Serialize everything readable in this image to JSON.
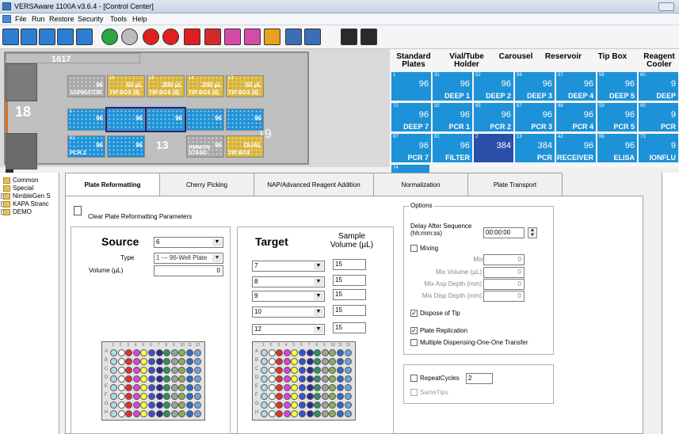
{
  "window": {
    "title": "VERSAware 1100A v3.6.4 - [Control Center]"
  },
  "menu": [
    "File",
    "Run",
    "Restore",
    "Security",
    "Tools",
    "Help"
  ],
  "toolbar": [
    "new-icon",
    "open-icon",
    "save-icon",
    "save-as-icon",
    "delete-icon",
    "run-icon",
    "pause-icon",
    "stop-icon",
    "refresh-icon",
    "home-icon",
    "info-icon",
    "deck-icon",
    "transfer-icon",
    "color-grid-icon",
    "plate-icon",
    "layout-icon",
    "columns-icon",
    "list-icon"
  ],
  "deck": {
    "header_label": "1617",
    "side_number": "18",
    "station_19": "19",
    "station_13": "13",
    "positions": [
      {
        "slot": "",
        "top": "96",
        "bottom": "ASPIRATOR",
        "type": "aspirator"
      },
      {
        "slot": "16",
        "top": "50 µL",
        "bottom": "TIP BOX (8)",
        "type": "tip"
      },
      {
        "slot": "15",
        "top": "200 µL",
        "bottom": "TIP BOX (8)",
        "type": "tip"
      },
      {
        "slot": "14",
        "top": "200 µL",
        "bottom": "TIP BOX (8)",
        "type": "tip"
      },
      {
        "slot": "13",
        "top": "50 µL",
        "bottom": "TIP BOX (8)",
        "type": "tip"
      },
      {
        "slot": "1",
        "top": "96",
        "bottom": "",
        "type": "plate"
      },
      {
        "slot": "",
        "top": "96",
        "bottom": "",
        "type": "plate-sel"
      },
      {
        "slot": "",
        "top": "96",
        "bottom": "",
        "type": "plate-sel"
      },
      {
        "slot": "",
        "top": "96",
        "bottom": "",
        "type": "plate"
      },
      {
        "slot": "",
        "top": "96",
        "bottom": "",
        "type": "plate"
      },
      {
        "slot": "62",
        "top": "96",
        "bottom": "PCR 2",
        "type": "pcr"
      },
      {
        "slot": "",
        "top": "96",
        "bottom": "",
        "type": "plate"
      },
      {
        "slot": "",
        "top": "96",
        "bottom": "AMMON STAND",
        "type": "stand"
      },
      {
        "slot": "",
        "top": "DUAL",
        "bottom": "TIP BOX",
        "type": "tip"
      }
    ]
  },
  "plate_tabs": {
    "headers": [
      "Standard Plates",
      "Vial/Tube Holder",
      "Carousel",
      "Reservoir",
      "Tip Box",
      "Reagent Cooler"
    ],
    "plates": [
      {
        "n": "1",
        "v": "96",
        "m": ""
      },
      {
        "n": "31",
        "v": "96",
        "m": "DEEP 1"
      },
      {
        "n": "52",
        "v": "96",
        "m": "DEEP 2"
      },
      {
        "n": "56",
        "v": "96",
        "m": "DEEP 3"
      },
      {
        "n": "57",
        "v": "96",
        "m": "DEEP 4"
      },
      {
        "n": "58",
        "v": "96",
        "m": "DEEP 5"
      },
      {
        "n": "60",
        "v": "9",
        "m": "DEEP"
      },
      {
        "n": "72",
        "v": "96",
        "m": "DEEP 7"
      },
      {
        "n": "32",
        "v": "96",
        "m": "PCR 1"
      },
      {
        "n": "85",
        "v": "96",
        "m": "PCR 2"
      },
      {
        "n": "87",
        "v": "96",
        "m": "PCR 3"
      },
      {
        "n": "88",
        "v": "96",
        "m": "PCR 4"
      },
      {
        "n": "59",
        "v": "96",
        "m": "PCR 5"
      },
      {
        "n": "90",
        "v": "9",
        "m": "PCR"
      },
      {
        "n": "87",
        "v": "96",
        "m": "PCR 7"
      },
      {
        "n": "81",
        "v": "96",
        "m": "FILTER"
      },
      {
        "n": "2",
        "v": "384",
        "m": ""
      },
      {
        "n": "13",
        "v": "384",
        "m": "PCR"
      },
      {
        "n": "42",
        "v": "96",
        "m": "RECEIVER"
      },
      {
        "n": "69",
        "v": "96",
        "m": "ELISA"
      },
      {
        "n": "73",
        "v": "9",
        "m": "IONFLU"
      },
      {
        "n": "74",
        "v": "",
        "m": ""
      }
    ]
  },
  "tree": [
    {
      "label": "Common",
      "expand": ""
    },
    {
      "label": "Special",
      "expand": ""
    },
    {
      "label": "NimbleGen S",
      "expand": "+"
    },
    {
      "label": "KAPA Stranc",
      "expand": "+"
    },
    {
      "label": "DEMO",
      "expand": "+"
    }
  ],
  "tabs": [
    "Plate Reformatting",
    "Cherry Picking",
    "NAP/Advanced Reagent Addition",
    "Normalization",
    "Plate Transport"
  ],
  "clear_label": "Clear Plate Reformatting Parameters",
  "source": {
    "title": "Source",
    "value": "6",
    "type_label": "Type",
    "type_value": "1 --- 96-Well Plate",
    "volume_label": "Volume (µL)",
    "volume_value": "0"
  },
  "target": {
    "title": "Target",
    "sample_volume_label": "Sample Volume (µL)",
    "rows": [
      {
        "plate": "7",
        "vol": "15"
      },
      {
        "plate": "8",
        "vol": "15"
      },
      {
        "plate": "9",
        "vol": "15"
      },
      {
        "plate": "10",
        "vol": "15"
      },
      {
        "plate": "12",
        "vol": "15"
      }
    ]
  },
  "options": {
    "group": "Options",
    "delay_label": "Delay After Sequence (hh:mm:ss)",
    "delay_value": "00:00:00",
    "mixing_label": "Mixing",
    "mix_cycles_label": "Mix Cycles",
    "mix_cycles": "0",
    "mix_volume_label": "Mix Volume (µL)",
    "mix_volume": "0",
    "mix_asp_label": "Mix Asp Depth (mm)",
    "mix_asp": "0",
    "mix_disp_label": "Mix Disp Depth (mm)",
    "mix_disp": "0",
    "dispose_label": "Dispose of Tip",
    "replication_label": "Plate Replication",
    "multi_label": "Multiple Dispensing-One-One Transfer",
    "repeat_label": "RepeatCycles",
    "repeat_value": "2",
    "sametips_label": "SameTips"
  },
  "plate_map": {
    "rows": [
      "A",
      "B",
      "C",
      "D",
      "E",
      "F",
      "G",
      "H"
    ],
    "cols": [
      "1",
      "2",
      "3",
      "4",
      "5",
      "6",
      "7",
      "8",
      "9",
      "10",
      "11",
      "12"
    ],
    "colors": [
      "#b0d8ee",
      "#ffffff",
      "#e33030",
      "#e040e0",
      "#ffff33",
      "#3a4fcf",
      "#2a2a9a",
      "#2d8f63",
      "#a0a0a0",
      "#8ab05a",
      "#2e6ac8",
      "#6da0e0"
    ]
  }
}
